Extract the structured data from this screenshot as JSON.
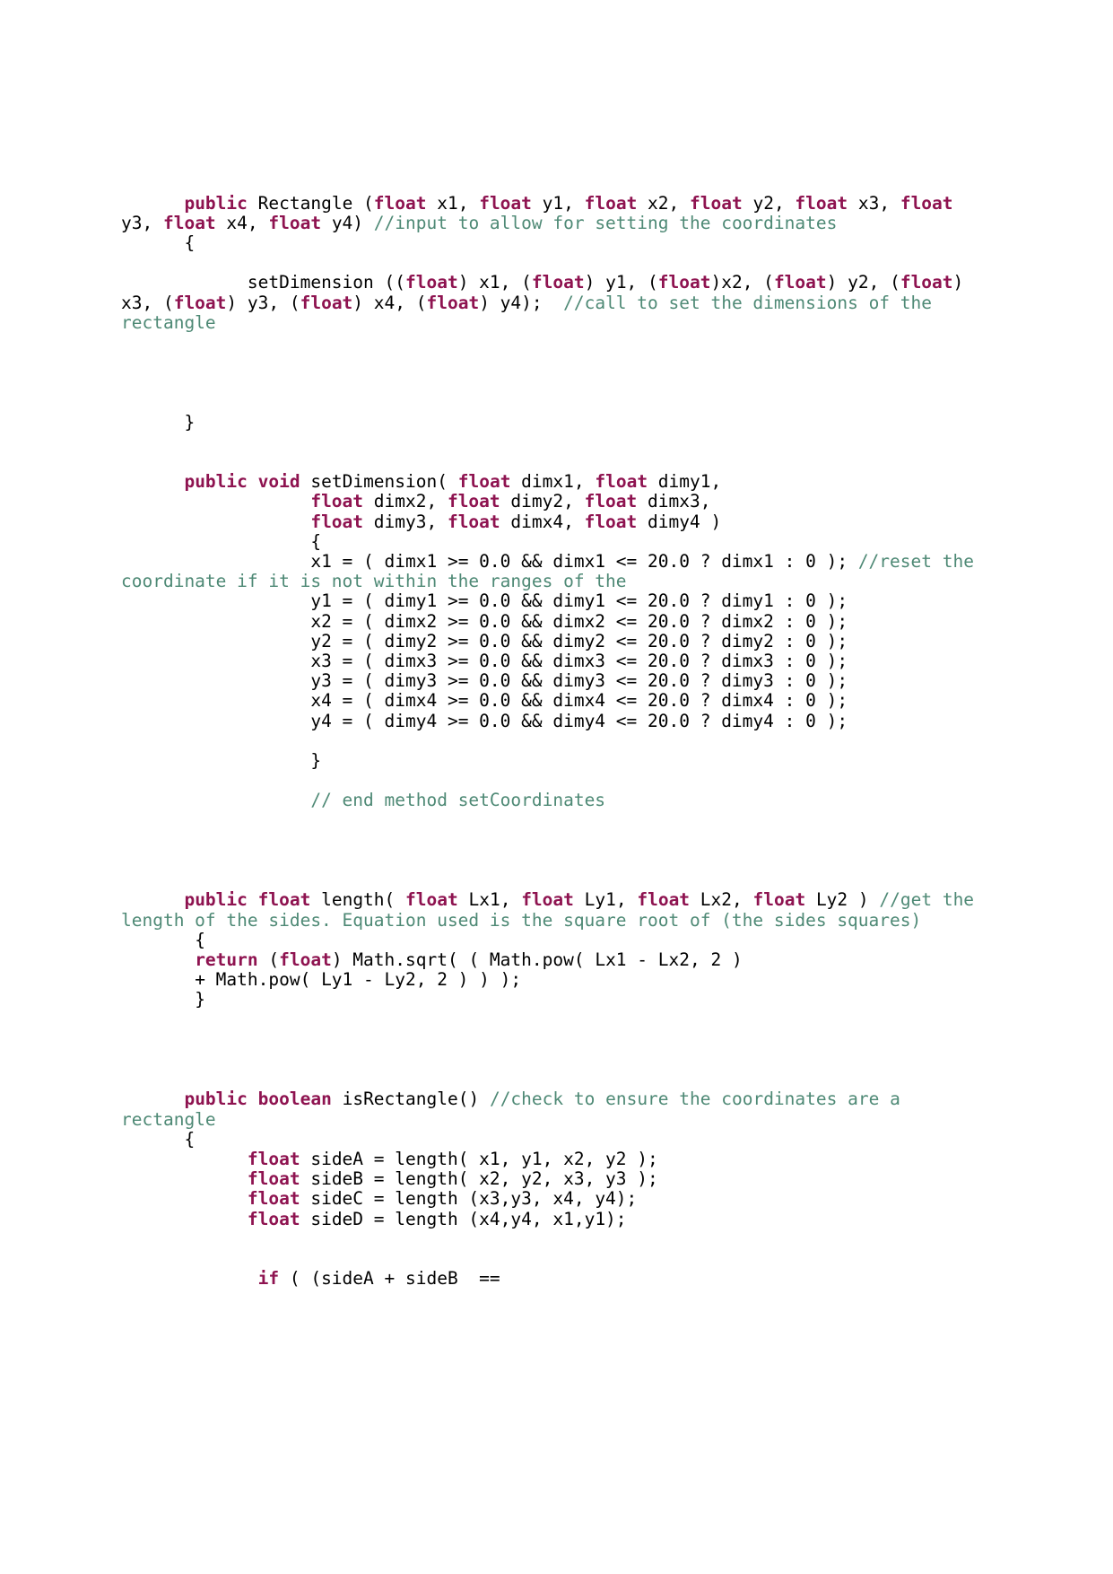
{
  "document": {
    "kind": "java-source-listing",
    "language": "Java",
    "background_color": "#ffffff",
    "colors": {
      "keyword": "#8E1350",
      "comment": "#4E8975",
      "plain": "#000000",
      "page": "#ffffff"
    }
  },
  "code": {
    "lines": [
      {
        "id": "line-constructor-signature",
        "segments": [
          {
            "t": "      ",
            "k": "pl"
          },
          {
            "t": "public",
            "k": "kw"
          },
          {
            "t": " Rectangle (",
            "k": "pl"
          },
          {
            "t": "float",
            "k": "kw"
          },
          {
            "t": " x1, ",
            "k": "pl"
          },
          {
            "t": "float",
            "k": "kw"
          },
          {
            "t": " y1, ",
            "k": "pl"
          },
          {
            "t": "float",
            "k": "kw"
          },
          {
            "t": " x2, ",
            "k": "pl"
          },
          {
            "t": "float",
            "k": "kw"
          },
          {
            "t": " y2, ",
            "k": "pl"
          },
          {
            "t": "float",
            "k": "kw"
          },
          {
            "t": " x3, ",
            "k": "pl"
          },
          {
            "t": "float",
            "k": "kw"
          },
          {
            "t": " y3, ",
            "k": "pl"
          },
          {
            "t": "float",
            "k": "kw"
          },
          {
            "t": " x4, ",
            "k": "pl"
          },
          {
            "t": "float",
            "k": "kw"
          },
          {
            "t": " y4) ",
            "k": "pl"
          },
          {
            "t": "//input to allow for setting the coordinates",
            "k": "cm"
          }
        ]
      },
      {
        "id": "line-constructor-open-brace",
        "segments": [
          {
            "t": "      {",
            "k": "pl"
          }
        ]
      },
      {
        "id": "blank-1",
        "blank": true
      },
      {
        "id": "line-setdimension-call",
        "segments": [
          {
            "t": "            setDimension ((",
            "k": "pl"
          },
          {
            "t": "float",
            "k": "kw"
          },
          {
            "t": ") x1, (",
            "k": "pl"
          },
          {
            "t": "float",
            "k": "kw"
          },
          {
            "t": ") y1, (",
            "k": "pl"
          },
          {
            "t": "float",
            "k": "kw"
          },
          {
            "t": ")x2, (",
            "k": "pl"
          },
          {
            "t": "float",
            "k": "kw"
          },
          {
            "t": ") y2, (",
            "k": "pl"
          },
          {
            "t": "float",
            "k": "kw"
          },
          {
            "t": ") x3, (",
            "k": "pl"
          },
          {
            "t": "float",
            "k": "kw"
          },
          {
            "t": ") y3, (",
            "k": "pl"
          },
          {
            "t": "float",
            "k": "kw"
          },
          {
            "t": ") x4, (",
            "k": "pl"
          },
          {
            "t": "float",
            "k": "kw"
          },
          {
            "t": ") y4);  ",
            "k": "pl"
          },
          {
            "t": "//call to set the dimensions of the rectangle",
            "k": "cm"
          }
        ]
      },
      {
        "id": "blank-2",
        "blank": true
      },
      {
        "id": "blank-3",
        "blank": true
      },
      {
        "id": "blank-4",
        "blank": true
      },
      {
        "id": "blank-5",
        "blank": true
      },
      {
        "id": "line-constructor-close-brace",
        "segments": [
          {
            "t": "      }",
            "k": "pl"
          }
        ]
      },
      {
        "id": "blank-6",
        "blank": true
      },
      {
        "id": "blank-7",
        "blank": true
      },
      {
        "id": "line-setdimension-signature-1",
        "segments": [
          {
            "t": "      ",
            "k": "pl"
          },
          {
            "t": "public",
            "k": "kw"
          },
          {
            "t": " ",
            "k": "pl"
          },
          {
            "t": "void",
            "k": "kw"
          },
          {
            "t": " setDimension( ",
            "k": "pl"
          },
          {
            "t": "float",
            "k": "kw"
          },
          {
            "t": " dimx1, ",
            "k": "pl"
          },
          {
            "t": "float",
            "k": "kw"
          },
          {
            "t": " dimy1,",
            "k": "pl"
          }
        ]
      },
      {
        "id": "line-setdimension-signature-2",
        "segments": [
          {
            "t": "                  ",
            "k": "pl"
          },
          {
            "t": "float",
            "k": "kw"
          },
          {
            "t": " dimx2, ",
            "k": "pl"
          },
          {
            "t": "float",
            "k": "kw"
          },
          {
            "t": " dimy2, ",
            "k": "pl"
          },
          {
            "t": "float",
            "k": "kw"
          },
          {
            "t": " dimx3,",
            "k": "pl"
          }
        ]
      },
      {
        "id": "line-setdimension-signature-3",
        "segments": [
          {
            "t": "                  ",
            "k": "pl"
          },
          {
            "t": "float",
            "k": "kw"
          },
          {
            "t": " dimy3, ",
            "k": "pl"
          },
          {
            "t": "float",
            "k": "kw"
          },
          {
            "t": " dimx4, ",
            "k": "pl"
          },
          {
            "t": "float",
            "k": "kw"
          },
          {
            "t": " dimy4 )",
            "k": "pl"
          }
        ]
      },
      {
        "id": "line-setdimension-open-brace",
        "segments": [
          {
            "t": "                  {",
            "k": "pl"
          }
        ]
      },
      {
        "id": "line-assign-x1",
        "segments": [
          {
            "t": "                  x1 = ( dimx1 >= 0.0 && dimx1 <= 20.0 ? dimx1 : 0 ); ",
            "k": "pl"
          },
          {
            "t": "//reset the coordinate if it is not within the ranges of the",
            "k": "cm"
          }
        ]
      },
      {
        "id": "line-assign-y1",
        "segments": [
          {
            "t": "                  y1 = ( dimy1 >= 0.0 && dimy1 <= 20.0 ? dimy1 : 0 );",
            "k": "pl"
          }
        ]
      },
      {
        "id": "line-assign-x2",
        "segments": [
          {
            "t": "                  x2 = ( dimx2 >= 0.0 && dimx2 <= 20.0 ? dimx2 : 0 );",
            "k": "pl"
          }
        ]
      },
      {
        "id": "line-assign-y2",
        "segments": [
          {
            "t": "                  y2 = ( dimy2 >= 0.0 && dimy2 <= 20.0 ? dimy2 : 0 );",
            "k": "pl"
          }
        ]
      },
      {
        "id": "line-assign-x3",
        "segments": [
          {
            "t": "                  x3 = ( dimx3 >= 0.0 && dimx3 <= 20.0 ? dimx3 : 0 );",
            "k": "pl"
          }
        ]
      },
      {
        "id": "line-assign-y3",
        "segments": [
          {
            "t": "                  y3 = ( dimy3 >= 0.0 && dimy3 <= 20.0 ? dimy3 : 0 );",
            "k": "pl"
          }
        ]
      },
      {
        "id": "line-assign-x4",
        "segments": [
          {
            "t": "                  x4 = ( dimx4 >= 0.0 && dimx4 <= 20.0 ? dimx4 : 0 );",
            "k": "pl"
          }
        ]
      },
      {
        "id": "line-assign-y4",
        "segments": [
          {
            "t": "                  y4 = ( dimy4 >= 0.0 && dimy4 <= 20.0 ? dimy4 : 0 );",
            "k": "pl"
          }
        ]
      },
      {
        "id": "blank-8",
        "blank": true
      },
      {
        "id": "line-setdimension-close-brace",
        "segments": [
          {
            "t": "                  }",
            "k": "pl"
          }
        ]
      },
      {
        "id": "blank-9",
        "blank": true
      },
      {
        "id": "line-comment-end-setcoordinates",
        "segments": [
          {
            "t": "                  ",
            "k": "pl"
          },
          {
            "t": "// end method setCoordinates",
            "k": "cm"
          }
        ]
      },
      {
        "id": "blank-10",
        "blank": true
      },
      {
        "id": "blank-11",
        "blank": true
      },
      {
        "id": "blank-12",
        "blank": true
      },
      {
        "id": "blank-13",
        "blank": true
      },
      {
        "id": "line-length-signature",
        "segments": [
          {
            "t": "      ",
            "k": "pl"
          },
          {
            "t": "public",
            "k": "kw"
          },
          {
            "t": " ",
            "k": "pl"
          },
          {
            "t": "float",
            "k": "kw"
          },
          {
            "t": " length( ",
            "k": "pl"
          },
          {
            "t": "float",
            "k": "kw"
          },
          {
            "t": " Lx1, ",
            "k": "pl"
          },
          {
            "t": "float",
            "k": "kw"
          },
          {
            "t": " Ly1, ",
            "k": "pl"
          },
          {
            "t": "float",
            "k": "kw"
          },
          {
            "t": " Lx2, ",
            "k": "pl"
          },
          {
            "t": "float",
            "k": "kw"
          },
          {
            "t": " Ly2 ) ",
            "k": "pl"
          },
          {
            "t": "//get the length of the sides. Equation used is the square root of (the sides squares)",
            "k": "cm"
          }
        ]
      },
      {
        "id": "line-length-open-brace",
        "segments": [
          {
            "t": "       {",
            "k": "pl"
          }
        ]
      },
      {
        "id": "line-length-return-1",
        "segments": [
          {
            "t": "       ",
            "k": "pl"
          },
          {
            "t": "return",
            "k": "kw"
          },
          {
            "t": " (",
            "k": "pl"
          },
          {
            "t": "float",
            "k": "kw"
          },
          {
            "t": ") Math.sqrt( ( Math.pow( Lx1 - Lx2, 2 )",
            "k": "pl"
          }
        ]
      },
      {
        "id": "line-length-return-2",
        "segments": [
          {
            "t": "       + Math.pow( Ly1 - Ly2, 2 ) ) );",
            "k": "pl"
          }
        ]
      },
      {
        "id": "line-length-close-brace",
        "segments": [
          {
            "t": "       }",
            "k": "pl"
          }
        ]
      },
      {
        "id": "blank-14",
        "blank": true
      },
      {
        "id": "blank-15",
        "blank": true
      },
      {
        "id": "blank-16",
        "blank": true
      },
      {
        "id": "blank-17",
        "blank": true
      },
      {
        "id": "line-isrectangle-signature",
        "segments": [
          {
            "t": "      ",
            "k": "pl"
          },
          {
            "t": "public",
            "k": "kw"
          },
          {
            "t": " ",
            "k": "pl"
          },
          {
            "t": "boolean",
            "k": "kw"
          },
          {
            "t": " isRectangle() ",
            "k": "pl"
          },
          {
            "t": "//check to ensure the coordinates are a rectangle",
            "k": "cm"
          }
        ]
      },
      {
        "id": "line-isrectangle-open-brace",
        "segments": [
          {
            "t": "      {",
            "k": "pl"
          }
        ]
      },
      {
        "id": "line-sidea",
        "segments": [
          {
            "t": "            ",
            "k": "pl"
          },
          {
            "t": "float",
            "k": "kw"
          },
          {
            "t": " sideA = length( x1, y1, x2, y2 );",
            "k": "pl"
          }
        ]
      },
      {
        "id": "line-sideb",
        "segments": [
          {
            "t": "            ",
            "k": "pl"
          },
          {
            "t": "float",
            "k": "kw"
          },
          {
            "t": " sideB = length( x2, y2, x3, y3 );",
            "k": "pl"
          }
        ]
      },
      {
        "id": "line-sidec",
        "segments": [
          {
            "t": "            ",
            "k": "pl"
          },
          {
            "t": "float",
            "k": "kw"
          },
          {
            "t": " sideC = length (x3,y3, x4, y4);",
            "k": "pl"
          }
        ]
      },
      {
        "id": "line-sided",
        "segments": [
          {
            "t": "            ",
            "k": "pl"
          },
          {
            "t": "float",
            "k": "kw"
          },
          {
            "t": " sideD = length (x4,y4, x1,y1);",
            "k": "pl"
          }
        ]
      },
      {
        "id": "blank-18",
        "blank": true
      },
      {
        "id": "blank-19",
        "blank": true
      },
      {
        "id": "line-if-condition",
        "segments": [
          {
            "t": "             ",
            "k": "pl"
          },
          {
            "t": "if",
            "k": "kw"
          },
          {
            "t": " ( (sideA + sideB  ==",
            "k": "pl"
          }
        ]
      }
    ]
  }
}
